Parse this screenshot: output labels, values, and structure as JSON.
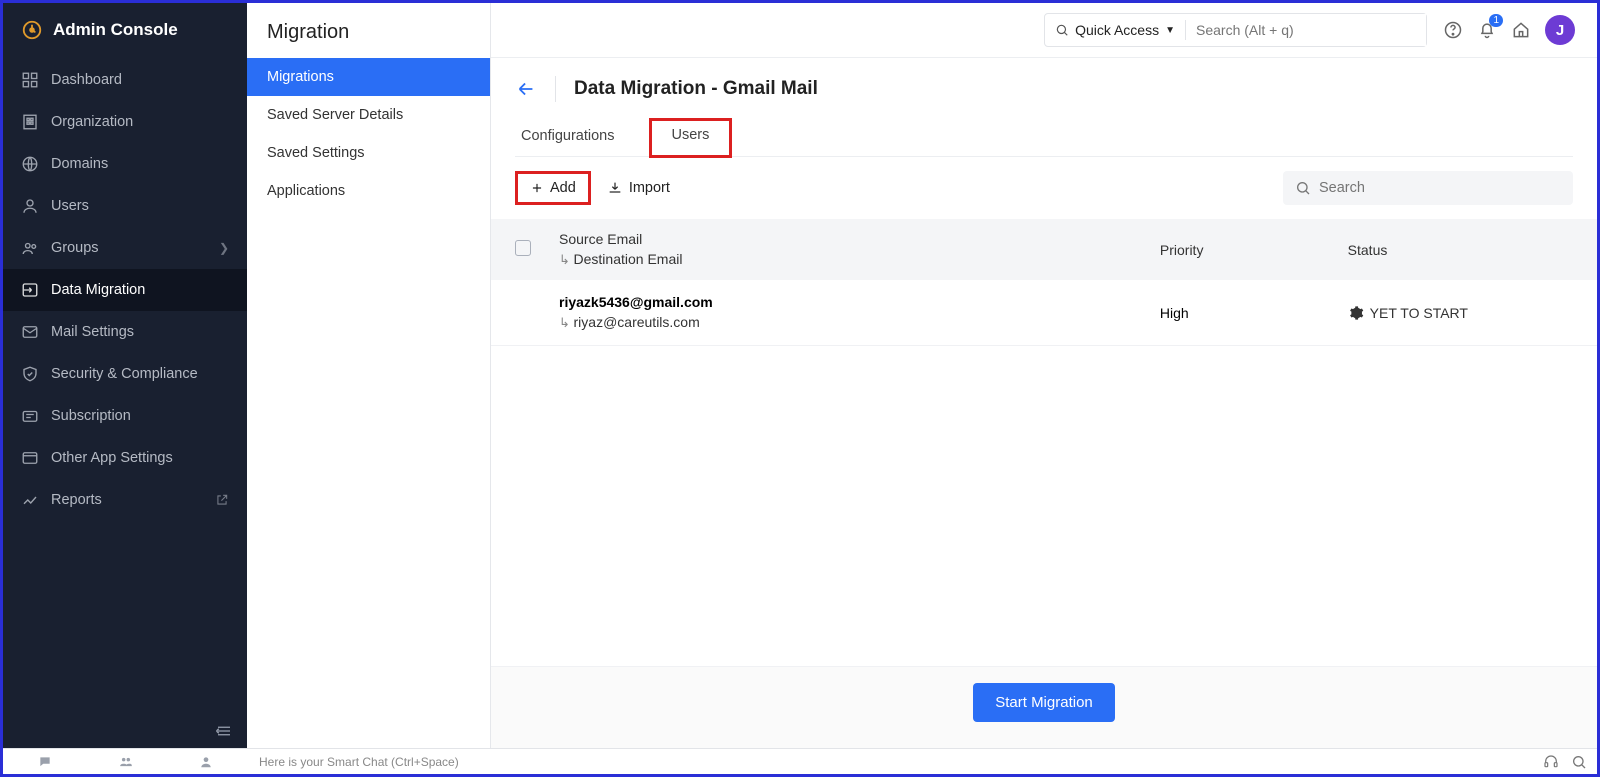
{
  "app": {
    "title": "Admin Console"
  },
  "sidebar": {
    "items": [
      {
        "label": "Dashboard"
      },
      {
        "label": "Organization"
      },
      {
        "label": "Domains"
      },
      {
        "label": "Users"
      },
      {
        "label": "Groups"
      },
      {
        "label": "Data Migration"
      },
      {
        "label": "Mail Settings"
      },
      {
        "label": "Security & Compliance"
      },
      {
        "label": "Subscription"
      },
      {
        "label": "Other App Settings"
      },
      {
        "label": "Reports"
      }
    ]
  },
  "subnav": {
    "title": "Migration",
    "items": [
      {
        "label": "Migrations"
      },
      {
        "label": "Saved Server Details"
      },
      {
        "label": "Saved Settings"
      },
      {
        "label": "Applications"
      }
    ]
  },
  "topbar": {
    "quick_access": "Quick Access",
    "search_placeholder": "Search (Alt + q)",
    "bell_badge": "1",
    "avatar_initial": "J"
  },
  "page": {
    "title": "Data Migration - Gmail Mail",
    "tabs": {
      "configurations": "Configurations",
      "users": "Users"
    }
  },
  "toolbar": {
    "add_label": "Add",
    "import_label": "Import",
    "search_placeholder": "Search"
  },
  "table": {
    "headers": {
      "source": "Source Email",
      "dest": "Destination Email",
      "priority": "Priority",
      "status": "Status"
    },
    "rows": [
      {
        "source": "riyazk5436@gmail.com",
        "dest": "riyaz@careutils.com",
        "priority": "High",
        "status": "YET TO START"
      }
    ]
  },
  "footer": {
    "start_label": "Start Migration"
  },
  "bottombar": {
    "hint": "Here is your Smart Chat (Ctrl+Space)"
  }
}
